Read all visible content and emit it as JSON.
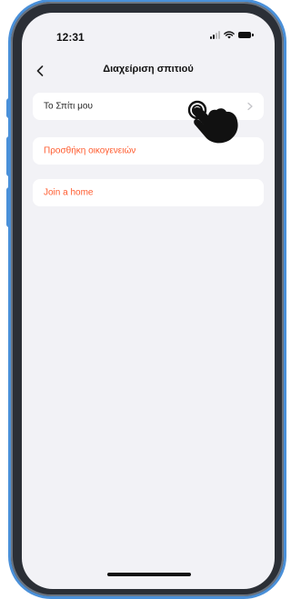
{
  "status_bar": {
    "time": "12:31"
  },
  "header": {
    "title": "Διαχείριση σπιτιού",
    "back_icon": "chevron-left-icon"
  },
  "homes": {
    "items": [
      {
        "label": "Το Σπίτι μου",
        "color": "#222222",
        "icon": "chevron-right-icon"
      }
    ]
  },
  "actions": {
    "add_family_label": "Προσθήκη οικογενειών",
    "join_home_label": "Join a home",
    "accent_color": "#ff5b2e"
  },
  "overlay": {
    "pointer_icon": "hand-pointer-icon"
  }
}
